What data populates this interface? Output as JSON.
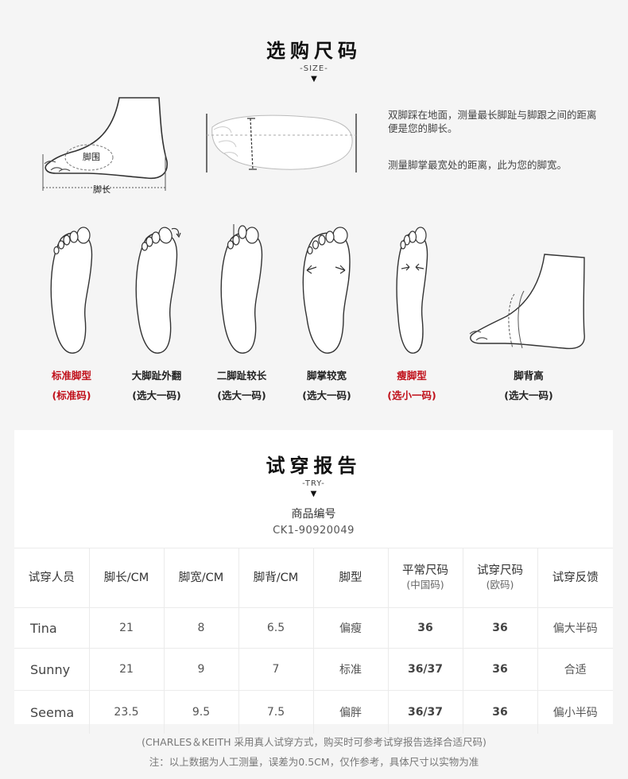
{
  "size_section": {
    "title": "选购尺码",
    "subtitle": "-SIZE-",
    "arrow": "▼",
    "diagram_labels": {
      "girth": "脚围",
      "length": "脚长"
    },
    "desc1": "双脚踩在地面，测量最长脚趾与脚跟之间的距离便是您的脚长。",
    "desc2": "测量脚掌最宽处的距离，此为您的脚宽。"
  },
  "foot_types": [
    {
      "label": "标准脚型",
      "note": "(标准码)",
      "highlight": true
    },
    {
      "label": "大脚趾外翻",
      "note": "(选大一码)",
      "highlight": false
    },
    {
      "label": "二脚趾较长",
      "note": "(选大一码)",
      "highlight": false
    },
    {
      "label": "脚掌较宽",
      "note": "(选大一码)",
      "highlight": false
    },
    {
      "label": "瘦脚型",
      "note": "(选小一码)",
      "highlight": true
    },
    {
      "label": "脚背高",
      "note": "(选大一码)",
      "highlight": false
    }
  ],
  "highlight_color": "#c0101a",
  "trial_section": {
    "title": "试穿报告",
    "subtitle": "-TRY-",
    "arrow": "▼",
    "code_label": "商品编号",
    "code_value": "CK1-90920049"
  },
  "table": {
    "headers": [
      {
        "main": "试穿人员",
        "sub": ""
      },
      {
        "main": "脚长/CM",
        "sub": ""
      },
      {
        "main": "脚宽/CM",
        "sub": ""
      },
      {
        "main": "脚背/CM",
        "sub": ""
      },
      {
        "main": "脚型",
        "sub": ""
      },
      {
        "main": "平常尺码",
        "sub": "(中国码)"
      },
      {
        "main": "试穿尺码",
        "sub": "(欧码)"
      },
      {
        "main": "试穿反馈",
        "sub": ""
      }
    ],
    "rows": [
      {
        "name": "Tina",
        "length": "21",
        "width": "8",
        "instep": "6.5",
        "type": "偏瘦",
        "normal": "36",
        "trial": "36",
        "feedback": "偏大半码"
      },
      {
        "name": "Sunny",
        "length": "21",
        "width": "9",
        "instep": "7",
        "type": "标准",
        "normal": "36/37",
        "trial": "36",
        "feedback": "合适"
      },
      {
        "name": "Seema",
        "length": "23.5",
        "width": "9.5",
        "instep": "7.5",
        "type": "偏胖",
        "normal": "36/37",
        "trial": "36",
        "feedback": "偏小半码"
      }
    ]
  },
  "footnotes": {
    "line1": "(CHARLES＆KEITH 采用真人试穿方式，购买时可参考试穿报告选择合适尺码)",
    "line2": "注：以上数据为人工测量，误差为0.5CM，仅作参考，具体尺寸以实物为准"
  }
}
